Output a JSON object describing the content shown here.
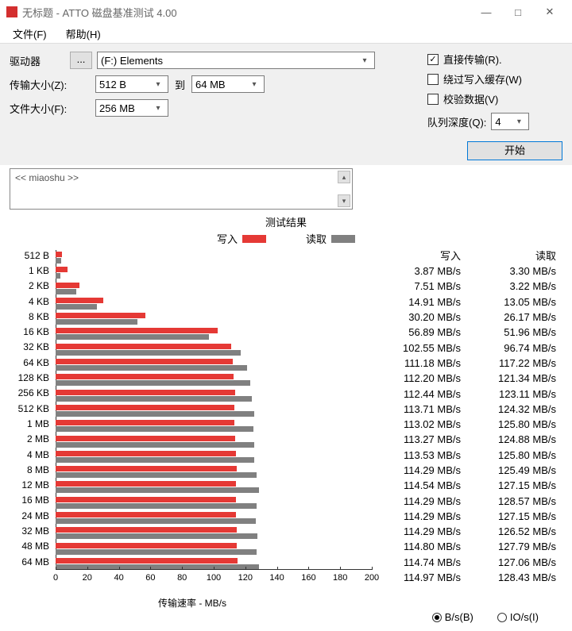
{
  "window": {
    "title": "无标题 - ATTO 磁盘基准测试 4.00"
  },
  "menu": {
    "file": "文件(F)",
    "help": "帮助(H)"
  },
  "labels": {
    "drive": "驱动器",
    "transferSize": "传输大小(Z):",
    "to": "到",
    "fileSize": "文件大小(F):",
    "queueDepth": "队列深度(Q):",
    "dots": "..."
  },
  "values": {
    "drive": "(F:) Elements",
    "tsFrom": "512 B",
    "tsTo": "64 MB",
    "fileSize": "256 MB",
    "queueDepth": "4"
  },
  "checks": {
    "direct": {
      "label": "直接传输(R).",
      "checked": true
    },
    "bypass": {
      "label": "绕过写入缓存(W)",
      "checked": false
    },
    "verify": {
      "label": "校验数据(V)",
      "checked": false
    }
  },
  "start": "开始",
  "desc": "<< miaoshu >>",
  "results": {
    "title": "测试结果",
    "writeLbl": "写入",
    "readLbl": "读取",
    "xaxis": "传输速率 - MB/s",
    "unitBs": "B/s(B)",
    "unitIOs": "IO/s(I)",
    "writeCol": "写入",
    "readCol": "读取"
  },
  "chart_data": {
    "type": "bar",
    "title": "测试结果",
    "xlabel": "传输速率 - MB/s",
    "xlim": [
      0,
      200
    ],
    "xticks": [
      0,
      20,
      40,
      60,
      80,
      100,
      120,
      140,
      160,
      180,
      200
    ],
    "categories": [
      "512 B",
      "1 KB",
      "2 KB",
      "4 KB",
      "8 KB",
      "16 KB",
      "32 KB",
      "64 KB",
      "128 KB",
      "256 KB",
      "512 KB",
      "1 MB",
      "2 MB",
      "4 MB",
      "8 MB",
      "12 MB",
      "16 MB",
      "24 MB",
      "32 MB",
      "48 MB",
      "64 MB"
    ],
    "series": [
      {
        "name": "写入",
        "color": "#e53935",
        "values": [
          3.87,
          7.51,
          14.91,
          30.2,
          56.89,
          102.55,
          111.18,
          112.2,
          112.44,
          113.71,
          113.02,
          113.27,
          113.53,
          114.29,
          114.54,
          114.29,
          114.29,
          114.29,
          114.8,
          114.74,
          114.97
        ]
      },
      {
        "name": "读取",
        "color": "#808080",
        "values": [
          3.3,
          3.22,
          13.05,
          26.17,
          51.96,
          96.74,
          117.22,
          121.34,
          123.11,
          124.32,
          125.8,
          124.88,
          125.8,
          125.49,
          127.15,
          128.57,
          127.15,
          126.52,
          127.79,
          127.06,
          128.43
        ]
      }
    ],
    "unit": "MB/s"
  }
}
